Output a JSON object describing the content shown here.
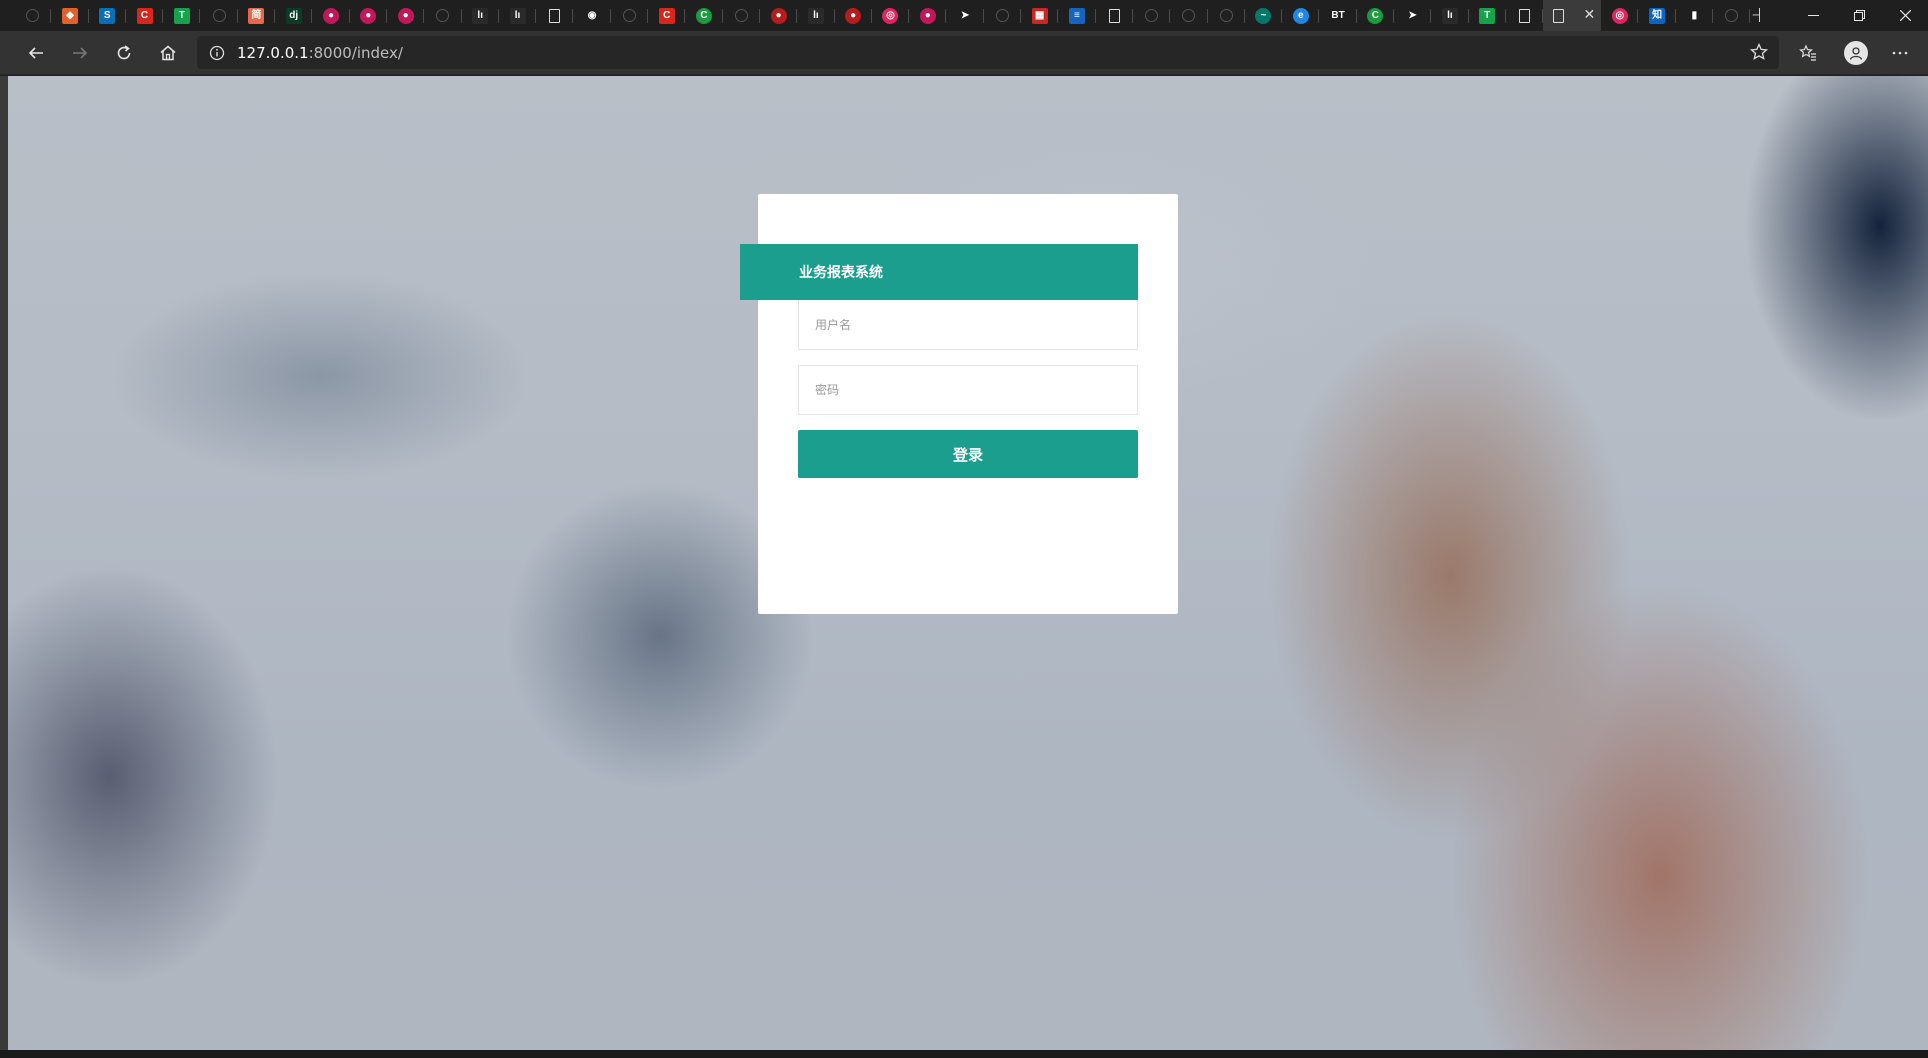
{
  "browser": {
    "favicons": [
      {
        "icon": "github-icon",
        "glyph": "",
        "bg": "#1f1f1f",
        "shape": "outline"
      },
      {
        "icon": "git-icon",
        "glyph": "◆",
        "bg": "#e0622a",
        "shape": "square"
      },
      {
        "icon": "vscode-icon",
        "glyph": "S",
        "bg": "#0b6fb8",
        "shape": "square"
      },
      {
        "icon": "csdn-icon",
        "glyph": "C",
        "bg": "#d8261c",
        "shape": "square"
      },
      {
        "icon": "t-icon",
        "glyph": "T",
        "bg": "#16a34a",
        "shape": "square"
      },
      {
        "icon": "github-icon",
        "glyph": "",
        "bg": "#1f1f1f",
        "shape": "outline"
      },
      {
        "icon": "jianshu-icon",
        "glyph": "简",
        "bg": "#e8664e",
        "shape": "square"
      },
      {
        "icon": "django-icon",
        "glyph": "dj",
        "bg": "#0c3c26",
        "shape": "square"
      },
      {
        "icon": "circle-red-icon",
        "glyph": "●",
        "bg": "#c2185b",
        "shape": "circle"
      },
      {
        "icon": "circle-red-icon",
        "glyph": "●",
        "bg": "#c2185b",
        "shape": "circle"
      },
      {
        "icon": "circle-red-icon",
        "glyph": "●",
        "bg": "#c2185b",
        "shape": "circle"
      },
      {
        "icon": "github-icon",
        "glyph": "",
        "bg": "#1f1f1f",
        "shape": "outline"
      },
      {
        "icon": "docs-icon",
        "glyph": "lı",
        "bg": "#2a2a2a",
        "shape": "square"
      },
      {
        "icon": "docs-icon",
        "glyph": "lı",
        "bg": "#2a2a2a",
        "shape": "square"
      },
      {
        "icon": "page-icon",
        "glyph": "",
        "bg": "#1f1f1f",
        "shape": "doc"
      },
      {
        "icon": "eye-icon",
        "glyph": "◉",
        "bg": "#1f1f1f",
        "shape": "square"
      },
      {
        "icon": "github-icon",
        "glyph": "",
        "bg": "#1f1f1f",
        "shape": "outline"
      },
      {
        "icon": "csdn-icon",
        "glyph": "C",
        "bg": "#d8261c",
        "shape": "square"
      },
      {
        "icon": "c-green-icon",
        "glyph": "C",
        "bg": "#1a9b3f",
        "shape": "circle"
      },
      {
        "icon": "github-icon",
        "glyph": "",
        "bg": "#1f1f1f",
        "shape": "outline"
      },
      {
        "icon": "circle-red-icon",
        "glyph": "●",
        "bg": "#b71c1c",
        "shape": "circle"
      },
      {
        "icon": "docs-icon",
        "glyph": "lı",
        "bg": "#2a2a2a",
        "shape": "square"
      },
      {
        "icon": "circle-red-icon",
        "glyph": "●",
        "bg": "#b71c1c",
        "shape": "circle"
      },
      {
        "icon": "weibo-icon",
        "glyph": "◎",
        "bg": "#e0245e",
        "shape": "circle"
      },
      {
        "icon": "circle-red-icon",
        "glyph": "●",
        "bg": "#c2185b",
        "shape": "circle"
      },
      {
        "icon": "send-icon",
        "glyph": "➤",
        "bg": "#1f1f1f",
        "shape": "square"
      },
      {
        "icon": "github-icon",
        "glyph": "",
        "bg": "#1f1f1f",
        "shape": "outline"
      },
      {
        "icon": "grid-red-icon",
        "glyph": "▦",
        "bg": "#c62828",
        "shape": "square"
      },
      {
        "icon": "doc-blue-icon",
        "glyph": "≡",
        "bg": "#1565c0",
        "shape": "square"
      },
      {
        "icon": "page-icon",
        "glyph": "",
        "bg": "#1f1f1f",
        "shape": "doc"
      },
      {
        "icon": "github-icon",
        "glyph": "",
        "bg": "#1f1f1f",
        "shape": "outline"
      },
      {
        "icon": "github-icon",
        "glyph": "",
        "bg": "#1f1f1f",
        "shape": "outline"
      },
      {
        "icon": "github-icon",
        "glyph": "",
        "bg": "#1f1f1f",
        "shape": "outline"
      },
      {
        "icon": "teal-icon",
        "glyph": "~",
        "bg": "#00796b",
        "shape": "circle"
      },
      {
        "icon": "edge-icon",
        "glyph": "e",
        "bg": "#1e88e5",
        "shape": "circle"
      },
      {
        "icon": "bt-icon",
        "glyph": "BT",
        "bg": "#1f1f1f",
        "shape": "square"
      },
      {
        "icon": "c-green-icon",
        "glyph": "C",
        "bg": "#1a9b3f",
        "shape": "circle"
      },
      {
        "icon": "send-icon",
        "glyph": "➤",
        "bg": "#1f1f1f",
        "shape": "square"
      },
      {
        "icon": "docs-icon",
        "glyph": "lı",
        "bg": "#2a2a2a",
        "shape": "square"
      },
      {
        "icon": "t-icon",
        "glyph": "T",
        "bg": "#16a34a",
        "shape": "square"
      },
      {
        "icon": "page-icon",
        "glyph": "",
        "bg": "#1f1f1f",
        "shape": "doc"
      }
    ],
    "favicons_after": [
      {
        "icon": "weibo-icon",
        "glyph": "◎",
        "bg": "#e0245e",
        "shape": "circle"
      },
      {
        "icon": "zhihu-icon",
        "glyph": "知",
        "bg": "#0a66c2",
        "shape": "square"
      },
      {
        "icon": "bar-chart-icon",
        "glyph": "▮",
        "bg": "#1f1f1f",
        "shape": "square"
      },
      {
        "icon": "github-icon",
        "glyph": "",
        "bg": "#1f1f1f",
        "shape": "outline"
      }
    ],
    "address": {
      "host": "127.0.0.1",
      "rest": ":8000/index/"
    }
  },
  "login": {
    "title": "业务报表系统",
    "username_placeholder": "用户名",
    "password_placeholder": "密码",
    "submit_label": "登录"
  },
  "colors": {
    "accent": "#1c9e8f",
    "card": "#ffffff"
  }
}
